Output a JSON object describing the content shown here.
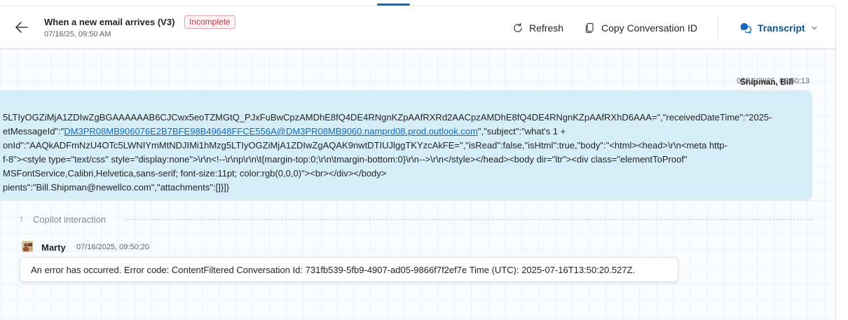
{
  "header": {
    "title": "When a new email arrives (V3)",
    "status_badge": "Incomplete",
    "timestamp": "07/16/25, 09:50 AM",
    "refresh_label": "Refresh",
    "copy_label": "Copy Conversation ID",
    "transcript_label": "Transcript"
  },
  "user_message": {
    "sender": "Shipman, Bill",
    "time": "07/16/2025, 09:50:13",
    "lines": [
      "5LTIyOGZiMjA1ZDIwZgBGAAAAAAB6CJCwx5eoTZMGtQ_PJxFuBwCpzAMDhE8fQ4DE4RNgnKZpAAfRXRd2AACpzAMDhE8fQ4DE4RNgnKZpAAfRXhD6AAA=\",\"receivedDateTime\":\"2025-",
      "etMessageId\":\"",
      "onId\":\"AAQkADFmNzU4OTc5LWNIYmMtNDJIMi1hMzg5LTIyOGZiMjA1ZDIwZgAQAK9nwtDTIUJlggTKYzcAkFE=\",\"isRead\":false,\"isHtml\":true,\"body\":\"<html><head>\\r\\n<meta http-",
      "f-8\"><style type=\"text/css\" style=\"display:none\">\\r\\n<!--\\r\\np\\r\\n\\t{margin-top:0;\\r\\n\\tmargin-bottom:0}\\r\\n-->\\r\\n</style></head><body dir=\"ltr\"><div class=\"elementToProof\"",
      "MSFontService,Calibri,Helvetica,sans-serif; font-size:11pt; color:rgb(0,0,0)\"><br></div></body>",
      "pients\":\"Bill.Shipman@newellco.com\",\"attachments\":[]}]}"
    ],
    "link_text": "DM3PR08MB906076E2B7BFE98B49648FFCE556A@DM3PR08MB9060.namprd08.prod.outlook.com",
    "line2_suffix": "\",\"subject\":\"what's 1 +"
  },
  "divider": {
    "label": "Copilot interaction"
  },
  "bot_message": {
    "sender": "Marty",
    "time": "07/16/2025, 09:50:20",
    "text": "An error has occurred. Error code: ContentFiltered Conversation Id: 731fb539-5fb9-4907-ad05-9866f7f2ef7e Time (UTC): 2025-07-16T13:50:20.527Z."
  },
  "colors": {
    "accent": "#0f6cbd",
    "error": "#c4314b",
    "user_bubble": "#d6eef8"
  },
  "icons": {
    "back": "arrow-left-icon",
    "refresh": "refresh-icon",
    "copy": "copy-icon",
    "transcript": "chat-bubbles-icon",
    "expand": "chevron-down-icon",
    "collapse": "arrow-up-icon",
    "avatar": "bot-avatar-icon"
  }
}
